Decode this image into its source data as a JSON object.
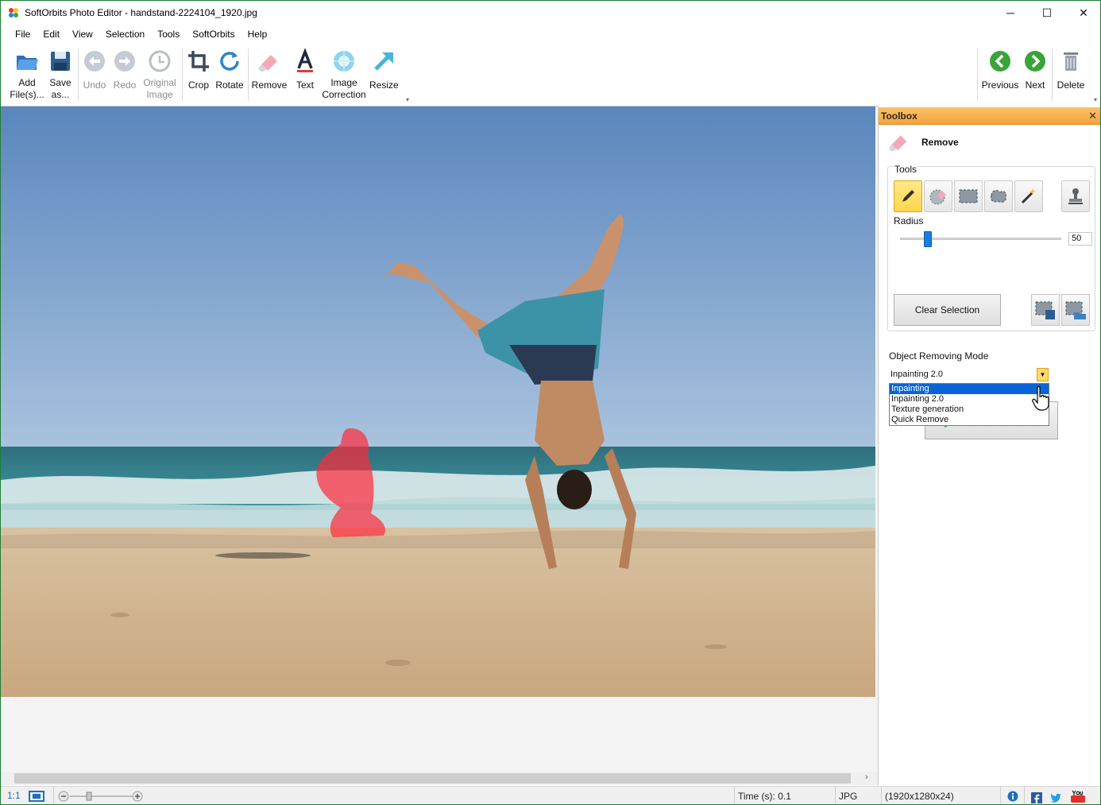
{
  "window": {
    "title": "SoftOrbits Photo Editor - handstand-2224104_1920.jpg",
    "controls": [
      "─",
      "☐",
      "✕"
    ]
  },
  "menu": [
    "File",
    "Edit",
    "View",
    "Selection",
    "Tools",
    "SoftOrbits",
    "Help"
  ],
  "toolbar": {
    "add_files": [
      "Add",
      "File(s)..."
    ],
    "save_as": [
      "Save",
      "as..."
    ],
    "undo": "Undo",
    "redo": "Redo",
    "original_image": [
      "Original",
      "Image"
    ],
    "crop": "Crop",
    "rotate": "Rotate",
    "remove": "Remove",
    "text": "Text",
    "image_correction": [
      "Image",
      "Correction"
    ],
    "resize": "Resize",
    "previous": "Previous",
    "next": "Next",
    "delete": "Delete"
  },
  "toolbox": {
    "header": "Toolbox",
    "close": "✕",
    "section_title": "Remove",
    "tools_label": "Tools",
    "radius_label": "Radius",
    "radius_value": "50",
    "clear_selection": "Clear Selection",
    "mode_label": "Object Removing Mode",
    "mode_selected": "Inpainting 2.0",
    "mode_options": [
      "Inpainting",
      "Inpainting 2.0",
      "Texture generation",
      "Quick Remove"
    ],
    "highlighted_option": "Inpainting"
  },
  "status": {
    "zoom_label": "1:1",
    "time": "Time (s): 0.1",
    "format": "JPG",
    "dimensions": "(1920x1280x24)"
  },
  "colors": {
    "accent_orange": "#f5a33a",
    "selection_blue": "#0a64d8",
    "arrow_green": "#3aa33a"
  }
}
